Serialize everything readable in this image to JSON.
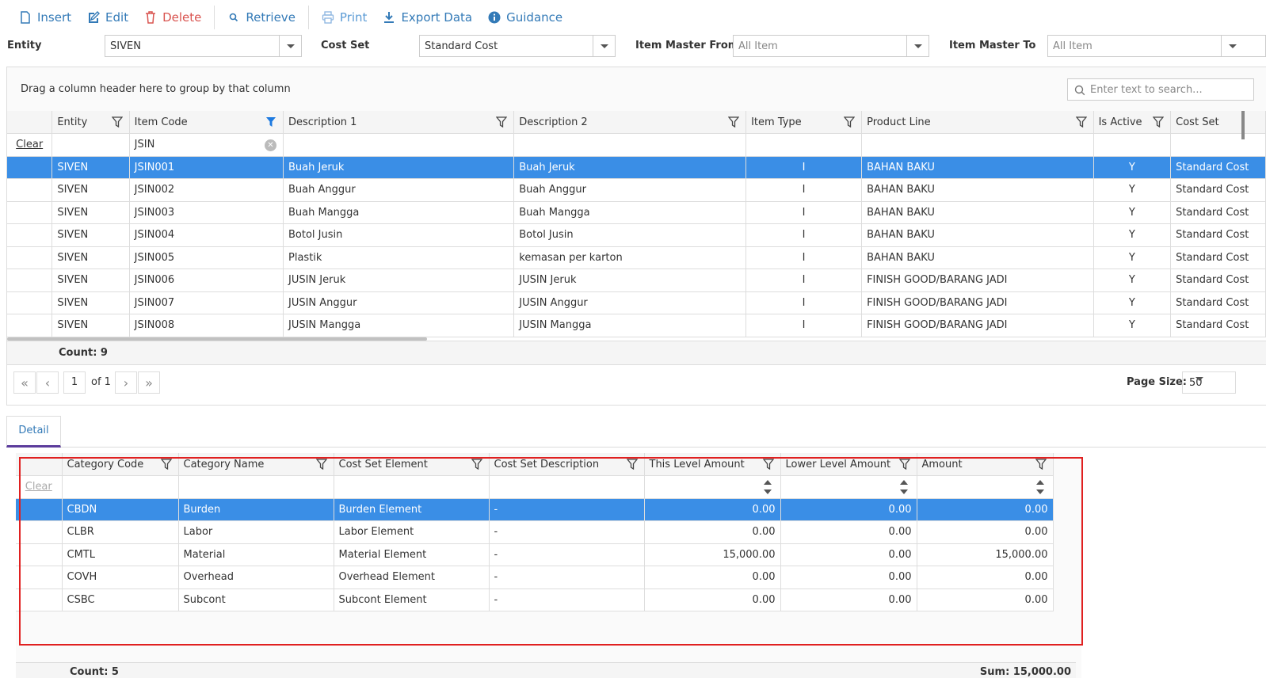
{
  "toolbar": {
    "insert": "Insert",
    "edit": "Edit",
    "delete": "Delete",
    "retrieve": "Retrieve",
    "print": "Print",
    "export": "Export Data",
    "guidance": "Guidance"
  },
  "filters": {
    "entity_label": "Entity",
    "entity_value": "SIVEN",
    "costset_label": "Cost Set",
    "costset_value": "Standard Cost",
    "from_label": "Item Master From",
    "from_value": "All Item",
    "to_label": "Item Master To",
    "to_value": "All Item"
  },
  "grid1": {
    "group_hint": "Drag a column header here to group by that column",
    "search_placeholder": "Enter text to search...",
    "headers": [
      "Entity",
      "Item Code",
      "Description 1",
      "Description 2",
      "Item Type",
      "Product Line",
      "Is Active",
      "Cost Set"
    ],
    "filter_row": {
      "clear": "Clear",
      "item_code": "JSIN"
    },
    "rows": [
      [
        "SIVEN",
        "JSIN001",
        "Buah Jeruk",
        "Buah Jeruk",
        "I",
        "BAHAN BAKU",
        "Y",
        "Standard Cost"
      ],
      [
        "SIVEN",
        "JSIN002",
        "Buah Anggur",
        "Buah Anggur",
        "I",
        "BAHAN BAKU",
        "Y",
        "Standard Cost"
      ],
      [
        "SIVEN",
        "JSIN003",
        "Buah Mangga",
        "Buah Mangga",
        "I",
        "BAHAN BAKU",
        "Y",
        "Standard Cost"
      ],
      [
        "SIVEN",
        "JSIN004",
        "Botol Jusin",
        "Botol Jusin",
        "I",
        "BAHAN BAKU",
        "Y",
        "Standard Cost"
      ],
      [
        "SIVEN",
        "JSIN005",
        "Plastik",
        "kemasan per karton",
        "I",
        "BAHAN BAKU",
        "Y",
        "Standard Cost"
      ],
      [
        "SIVEN",
        "JSIN006",
        "JUSIN Jeruk",
        "JUSIN Jeruk",
        "I",
        "FINISH GOOD/BARANG JADI",
        "Y",
        "Standard Cost"
      ],
      [
        "SIVEN",
        "JSIN007",
        "JUSIN Anggur",
        "JUSIN Anggur",
        "I",
        "FINISH GOOD/BARANG JADI",
        "Y",
        "Standard Cost"
      ],
      [
        "SIVEN",
        "JSIN008",
        "JUSIN Mangga",
        "JUSIN Mangga",
        "I",
        "FINISH GOOD/BARANG JADI",
        "Y",
        "Standard Cost"
      ]
    ],
    "count": "Count: 9",
    "pager": {
      "page": "1",
      "of": "of 1",
      "page_size_label": "Page Size:",
      "page_size": "50"
    }
  },
  "tabs": {
    "detail": "Detail"
  },
  "grid2": {
    "headers": [
      "Category Code",
      "Category Name",
      "Cost Set Element",
      "Cost Set Description",
      "This Level Amount",
      "Lower Level Amount",
      "Amount"
    ],
    "clear": "Clear",
    "rows": [
      [
        "CBDN",
        "Burden",
        "Burden Element",
        "-",
        "0.00",
        "0.00",
        "0.00"
      ],
      [
        "CLBR",
        "Labor",
        "Labor Element",
        "-",
        "0.00",
        "0.00",
        "0.00"
      ],
      [
        "CMTL",
        "Material",
        "Material Element",
        "-",
        "15,000.00",
        "0.00",
        "15,000.00"
      ],
      [
        "COVH",
        "Overhead",
        "Overhead Element",
        "-",
        "0.00",
        "0.00",
        "0.00"
      ],
      [
        "CSBC",
        "Subcont",
        "Subcont Element",
        "-",
        "0.00",
        "0.00",
        "0.00"
      ]
    ],
    "count": "Count: 5",
    "sum": "Sum: 15,000.00"
  }
}
